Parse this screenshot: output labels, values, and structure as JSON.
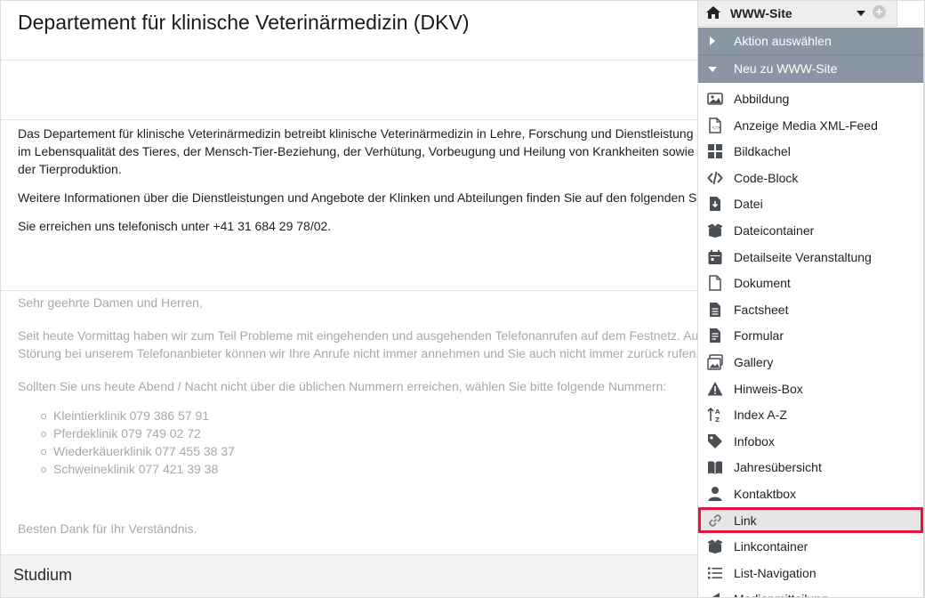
{
  "page": {
    "title": "Departement für klinische Veterinärmedizin (DKV)",
    "intro": [
      "Das Departement für klinische Veterinärmedizin betreibt klinische Veterinärmedizin in Lehre, Forschung und Dienstleistung im Lebensqualität des Tieres, der Mensch-Tier-Beziehung, der Verhütung, Vorbeugung und Heilung von Krankheiten sowie der Tierproduktion.",
      "Weitere Informationen über die Dienstleistungen und Angebote der Klinken und Abteilungen finden Sie auf den folgenden Se",
      "Sie erreichen uns telefonisch unter +41 31 684 29 78/02."
    ],
    "notice": {
      "greeting": "Sehr geehrte Damen und Herren,",
      "paragraph": "Seit heute Vormittag haben wir zum Teil Probleme mit eingehenden und ausgehenden Telefonanrufen auf dem Festnetz.  Au Störung bei unserem Telefonanbieter können wir Ihre Anrufe nicht immer annehmen und Sie auch nicht immer zurück rufen.",
      "instruction": "Sollten Sie uns heute Abend / Nacht nicht über die üblichen Nummern erreichen, wählen Sie bitte folgende Nummern:",
      "numbers": [
        "Kleintierklinik 079 386 57 91",
        "Pferdeklinik 079 749 02 72",
        "Wiederkäuerklinik 077 455 38 37",
        "Schweineklinik 077 421 39 38"
      ],
      "thanks": "Besten Dank für Ihr Verständnis."
    },
    "section_bar": "Studium"
  },
  "dropdown": {
    "site_label": "WWW-Site",
    "action_label": "Aktion auswählen",
    "new_label": "Neu zu WWW-Site",
    "items": [
      {
        "label": "Abbildung",
        "icon": "image-icon"
      },
      {
        "label": "Anzeige Media XML-Feed",
        "icon": "xml-file-icon"
      },
      {
        "label": "Bildkachel",
        "icon": "tiles-icon"
      },
      {
        "label": "Code-Block",
        "icon": "code-icon"
      },
      {
        "label": "Datei",
        "icon": "file-download-icon"
      },
      {
        "label": "Dateicontainer",
        "icon": "box-icon"
      },
      {
        "label": "Detailseite Veranstaltung",
        "icon": "calendar-icon"
      },
      {
        "label": "Dokument",
        "icon": "document-icon"
      },
      {
        "label": "Factsheet",
        "icon": "factsheet-icon"
      },
      {
        "label": "Formular",
        "icon": "form-icon"
      },
      {
        "label": "Gallery",
        "icon": "gallery-icon"
      },
      {
        "label": "Hinweis-Box",
        "icon": "warning-icon"
      },
      {
        "label": "Index A-Z",
        "icon": "sort-az-icon"
      },
      {
        "label": "Infobox",
        "icon": "tag-icon"
      },
      {
        "label": "Jahresübersicht",
        "icon": "book-icon"
      },
      {
        "label": "Kontaktbox",
        "icon": "person-icon"
      },
      {
        "label": "Link",
        "icon": "link-icon",
        "selected": true
      },
      {
        "label": "Linkcontainer",
        "icon": "box-icon"
      },
      {
        "label": "List-Navigation",
        "icon": "list-icon"
      },
      {
        "label": "Medienmitteilung",
        "icon": "megaphone-icon"
      }
    ]
  },
  "colors": {
    "menu_header": "#8a96a3",
    "selection_outline": "#e2163f",
    "icon": "#4a4f55"
  }
}
